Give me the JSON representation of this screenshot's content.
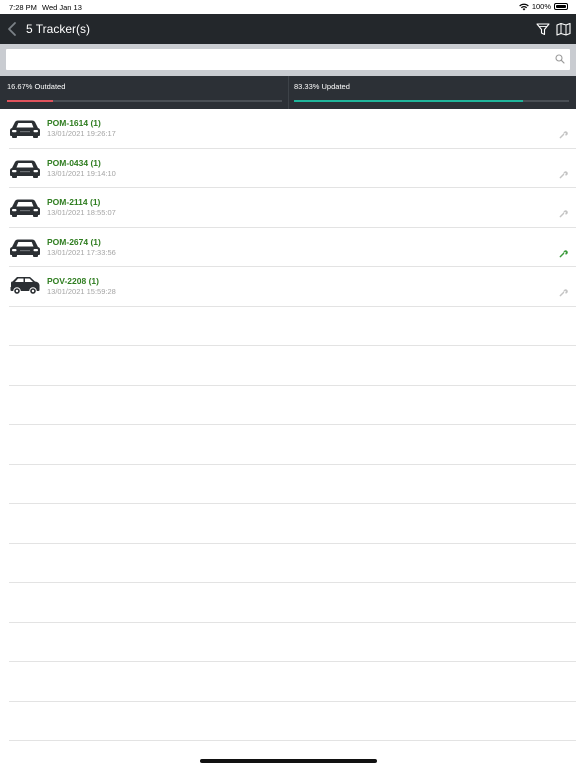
{
  "status_bar": {
    "time": "7:28 PM",
    "date": "Wed Jan 13",
    "battery": "100%"
  },
  "header": {
    "title": "5 Tracker(s)"
  },
  "search": {
    "placeholder": ""
  },
  "stats": {
    "outdated": {
      "label": "16.67% Outdated",
      "percent": 16.67,
      "color": "#e0525c"
    },
    "updated": {
      "label": "83.33% Updated",
      "percent": 83.33,
      "color": "#1fb59b"
    }
  },
  "trackers": [
    {
      "name": "POM-1614 (1)",
      "time": "13/01/2021 19:26:17",
      "vehicle": "sedan",
      "wrench_active": false
    },
    {
      "name": "POM-0434 (1)",
      "time": "13/01/2021 19:14:10",
      "vehicle": "sedan",
      "wrench_active": false
    },
    {
      "name": "POM-2114 (1)",
      "time": "13/01/2021 18:55:07",
      "vehicle": "sedan",
      "wrench_active": false
    },
    {
      "name": "POM-2674 (1)",
      "time": "13/01/2021 17:33:56",
      "vehicle": "sedan",
      "wrench_active": true
    },
    {
      "name": "POV-2208 (1)",
      "time": "13/01/2021 15:59:28",
      "vehicle": "suv",
      "wrench_active": false
    }
  ],
  "colors": {
    "name": "#2e7d1f",
    "wrench_active": "#3b9a3b",
    "wrench_inactive": "#c4c4c4",
    "nav": "#23272b",
    "stats_bg": "#2c3036"
  }
}
